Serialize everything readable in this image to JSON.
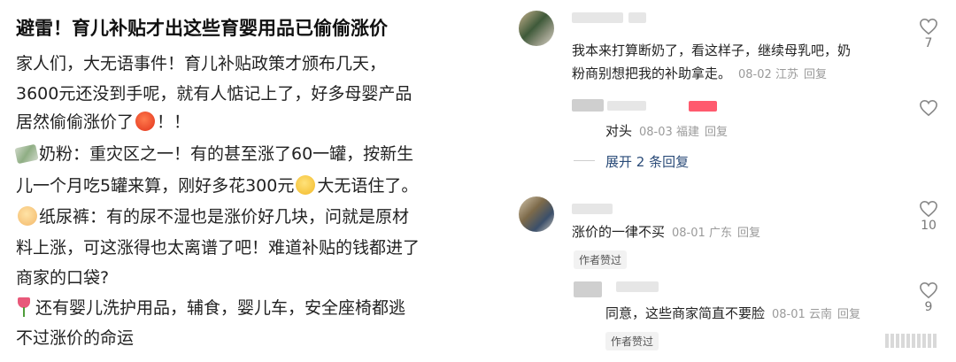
{
  "post": {
    "title": "避雷！育儿补贴才出这些育婴用品已偷偷涨价",
    "line1": "家人们，大无语事件！育儿补贴政策才颁布几天，",
    "line2": "3600元还没到手呢，就有人惦记上了，好多母婴产品",
    "line3_a": "居然偷偷涨价了",
    "line3_b": "！！",
    "line4": "奶粉：重灾区之一！有的甚至涨了60一罐，按新生",
    "line5_a": "儿一个月吃5罐来算，刚好多花300元",
    "line5_b": "大无语住了。",
    "line6": "纸尿裤：有的尿不湿也是涨价好几块，问就是原材",
    "line7": "料上涨，可这涨得也太离谱了吧！难道补贴的钱都进了",
    "line8": "商家的口袋?",
    "line9": "还有婴儿洗护用品，辅食，婴儿车，安全座椅都逃",
    "line10": "不过涨价的命运"
  },
  "comments": {
    "c1": {
      "text1": "我本来打算断奶了，看这样子，继续母乳吧，奶",
      "text2": "粉商别想把我的补助拿走。",
      "date": "08-02",
      "location": "江苏",
      "reply": "回复",
      "likes": "7"
    },
    "c1_reply": {
      "text": "对头",
      "date": "08-03",
      "location": "福建",
      "reply": "回复"
    },
    "c1_expand": "展开 2 条回复",
    "c2": {
      "text": "涨价的一律不买",
      "date": "08-01",
      "location": "广东",
      "reply": "回复",
      "likes": "10",
      "badge": "作者赞过"
    },
    "c2_reply": {
      "text": "同意，这些商家简直不要脸",
      "date": "08-01",
      "location": "云南",
      "reply": "回复",
      "likes": "9",
      "badge": "作者赞过"
    }
  },
  "icons": {
    "like": "heart-outline-icon",
    "emoji_angry": "angry-face-emoji",
    "emoji_money": "money-wings-emoji",
    "emoji_eyeroll": "eye-roll-emoji",
    "emoji_baby": "baby-emoji",
    "emoji_tulip": "tulip-emoji"
  },
  "colors": {
    "text": "#222222",
    "meta": "#9a9a9a",
    "link": "#2a4b78"
  }
}
